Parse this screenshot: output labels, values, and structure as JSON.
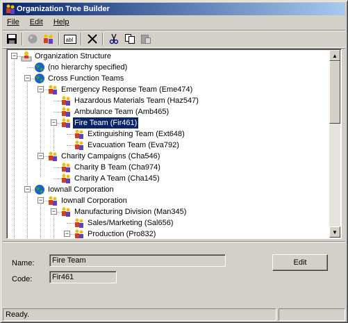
{
  "window": {
    "title": "Organization Tree Builder"
  },
  "menu": {
    "file": "File",
    "edit": "Edit",
    "help": "Help"
  },
  "toolbar": {
    "buttons": [
      {
        "name": "save-icon"
      },
      {
        "name": "globe-icon"
      },
      {
        "name": "people-add-icon"
      },
      {
        "name": "textbox-icon",
        "text": "abl"
      },
      {
        "name": "delete-x-icon"
      },
      {
        "name": "cut-icon"
      },
      {
        "name": "copy-icon"
      },
      {
        "name": "paste-icon"
      }
    ]
  },
  "tree": {
    "items": [
      {
        "label": "Organization Structure",
        "type": "root"
      },
      {
        "label": "(no hierarchy specified)",
        "type": "globe"
      },
      {
        "label": "Cross Function Teams",
        "type": "globe"
      },
      {
        "label": "Emergency Response Team (Eme474)",
        "type": "team"
      },
      {
        "label": "Hazardous Materials Team (Haz547)",
        "type": "team"
      },
      {
        "label": "Ambulance Team (Amb465)",
        "type": "team"
      },
      {
        "label": "Fire Team (Fir461)",
        "type": "team",
        "selected": true
      },
      {
        "label": "Extinguishing Team (Ext648)",
        "type": "team"
      },
      {
        "label": "Evacuation Team (Eva792)",
        "type": "team"
      },
      {
        "label": "Charity Campaigns (Cha546)",
        "type": "team"
      },
      {
        "label": "Charity B Team (Cha974)",
        "type": "team"
      },
      {
        "label": "Charity A Team (Cha145)",
        "type": "team"
      },
      {
        "label": "Iownall Corporation",
        "type": "globe"
      },
      {
        "label": "Iownall Corporation",
        "type": "team"
      },
      {
        "label": "Manufacturing Division (Man345)",
        "type": "team"
      },
      {
        "label": "Sales/Marketing (Sal656)",
        "type": "team"
      },
      {
        "label": "Production (Pro832)",
        "type": "team"
      }
    ]
  },
  "details": {
    "name_label": "Name:",
    "name_value": "Fire Team",
    "code_label": "Code:",
    "code_value": "Fir461",
    "edit_button": "Edit"
  },
  "status": {
    "text": "Ready."
  },
  "colors": {
    "selection": "#0a246a",
    "title_start": "#0a246a",
    "title_end": "#a6caf0"
  }
}
